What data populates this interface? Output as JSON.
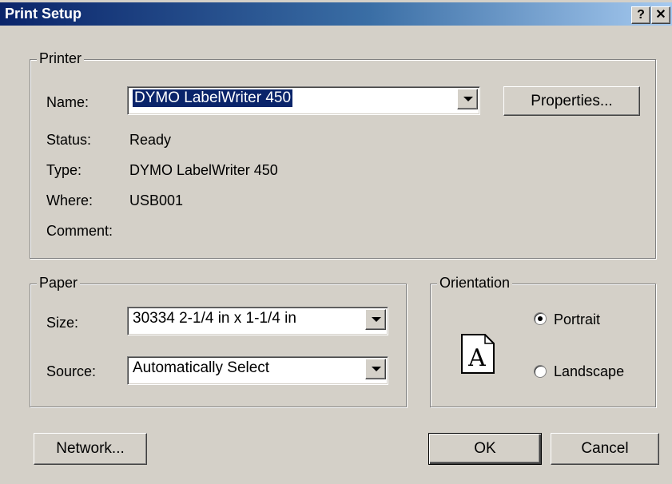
{
  "window": {
    "title": "Print Setup",
    "help_glyph": "?",
    "close_glyph": "✕"
  },
  "printer": {
    "group_label": "Printer",
    "name_label": "Name:",
    "name_value": "DYMO LabelWriter 450",
    "properties_button": "Properties...",
    "status_label": "Status:",
    "status_value": "Ready",
    "type_label": "Type:",
    "type_value": "DYMO LabelWriter 450",
    "where_label": "Where:",
    "where_value": "USB001",
    "comment_label": "Comment:",
    "comment_value": ""
  },
  "paper": {
    "group_label": "Paper",
    "size_label": "Size:",
    "size_value": "30334 2-1/4 in x 1-1/4 in",
    "source_label": "Source:",
    "source_value": "Automatically Select"
  },
  "orientation": {
    "group_label": "Orientation",
    "icon_letter": "A",
    "portrait_label": "Portrait",
    "landscape_label": "Landscape",
    "selected": "Portrait"
  },
  "buttons": {
    "network": "Network...",
    "ok": "OK",
    "cancel": "Cancel"
  },
  "icons": {
    "dropdown": "chevron-down-icon",
    "help": "help-icon",
    "close": "close-icon",
    "page": "page-orientation-icon"
  }
}
